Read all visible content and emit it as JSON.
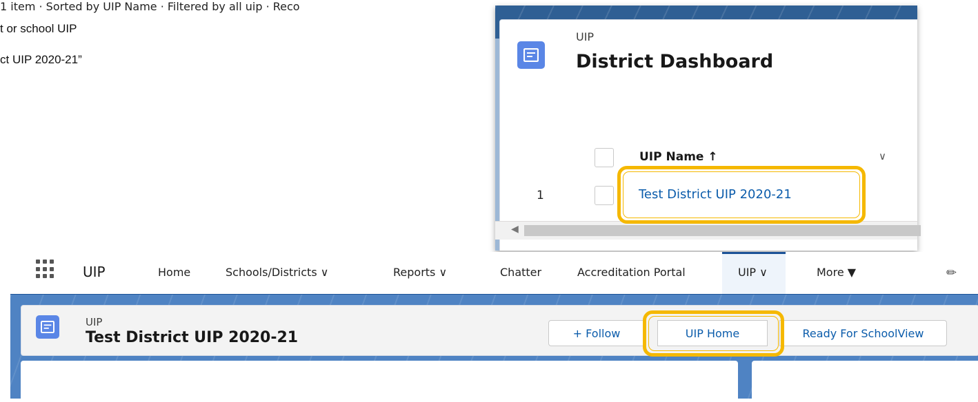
{
  "doc_text": {
    "line1": "t or school UIP",
    "line2": "ct UIP 2020-21”"
  },
  "list_view": {
    "object_type": "UIP",
    "title": "District Dashboard",
    "meta": "1 item · Sorted by UIP Name · Filtered by all uip · Reco",
    "column_header": "UIP Name ↑",
    "row_number": "1",
    "row_link": "Test District UIP 2020-21"
  },
  "nav": {
    "app_name": "UIP",
    "items": [
      "Home",
      "Schools/Districts ∨",
      "Reports ∨",
      "Chatter",
      "Accreditation Portal",
      "UIP ∨",
      "More ▼"
    ]
  },
  "record": {
    "object_type": "UIP",
    "title": "Test District UIP 2020-21",
    "follow_button": "+ Follow",
    "home_button": "UIP Home",
    "schoolview_button": "Ready For SchoolView"
  },
  "colors": {
    "highlight": "#f5b800",
    "nav_border": "#1b5297",
    "link": "#0b5cab",
    "icon_bg": "#5a86e6"
  },
  "icons": {
    "record_icon": "record-icon",
    "app_launcher": "app-launcher-icon",
    "pencil": "pencil-icon"
  }
}
